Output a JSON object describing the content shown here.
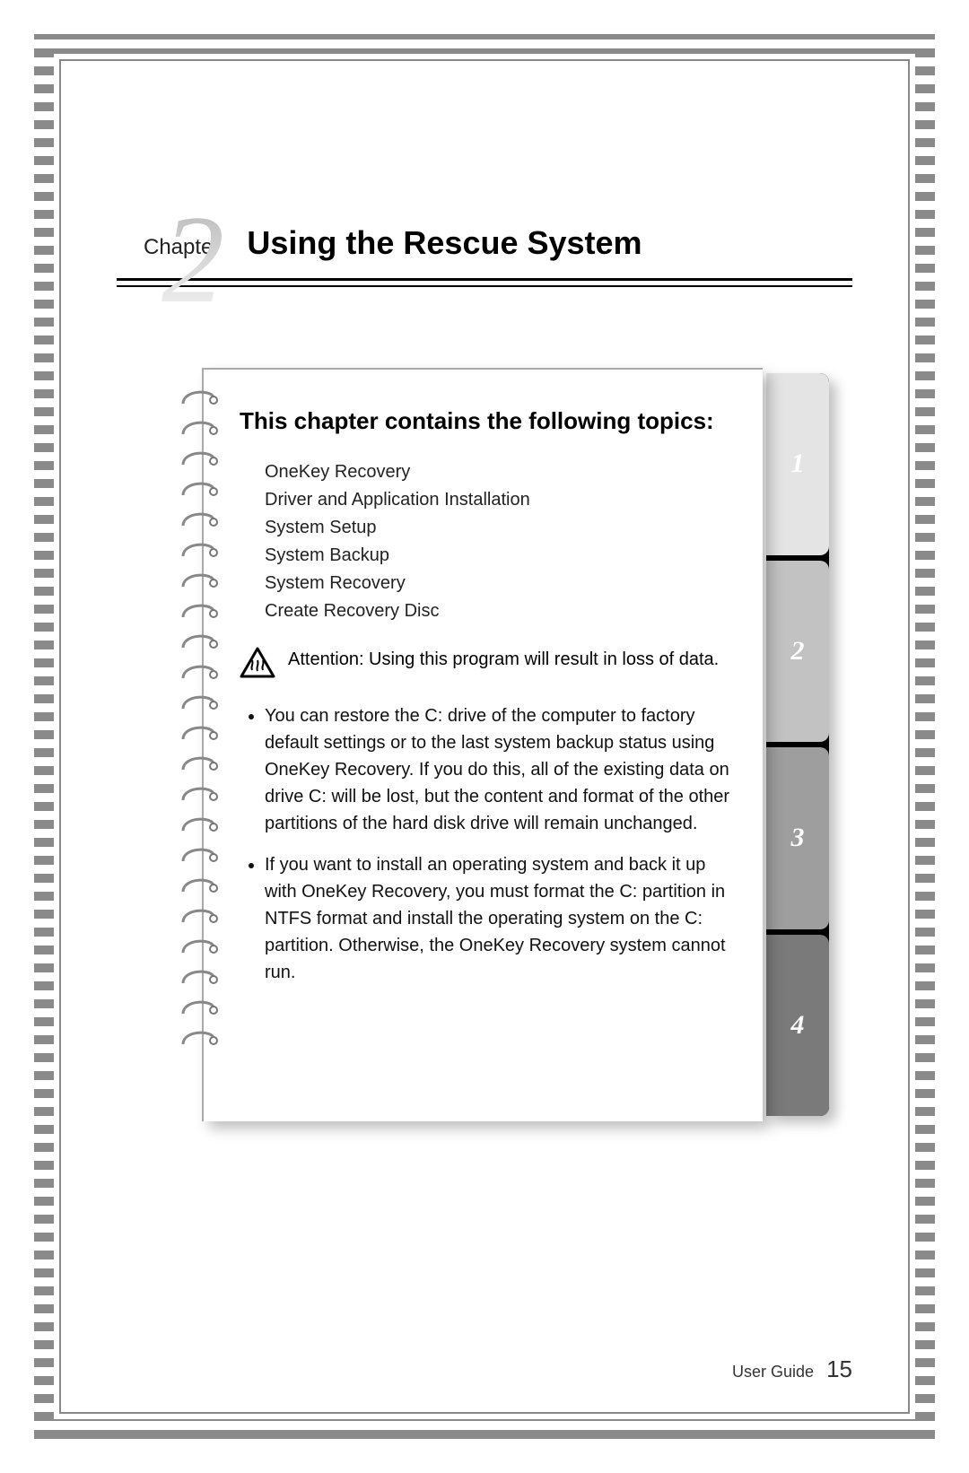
{
  "chapter": {
    "number": "2",
    "label": "Chapter",
    "title": "Using the Rescue System"
  },
  "notebook": {
    "heading": "This chapter contains the following topics:",
    "topics": [
      "OneKey Recovery",
      "Driver and Application Installation",
      "System Setup",
      "System Backup",
      "System Recovery",
      "Create Recovery Disc"
    ],
    "attention": "Attention: Using this program will result in loss of data.",
    "bullets": [
      "You can restore the C: drive of the computer to factory default settings or to the last system backup status using OneKey Recovery. If you do this, all of the existing data on drive C: will be lost, but the content and format of the other partitions of the hard disk drive will remain unchanged.",
      "If you want to install an operating system and back it up with OneKey Recovery, you must format the C: partition in NTFS format and install the operating system on the C: partition. Otherwise, the OneKey Recovery system cannot run."
    ]
  },
  "tabs": [
    "1",
    "2",
    "3",
    "4"
  ],
  "footer": {
    "label": "User Guide",
    "page": "15"
  }
}
